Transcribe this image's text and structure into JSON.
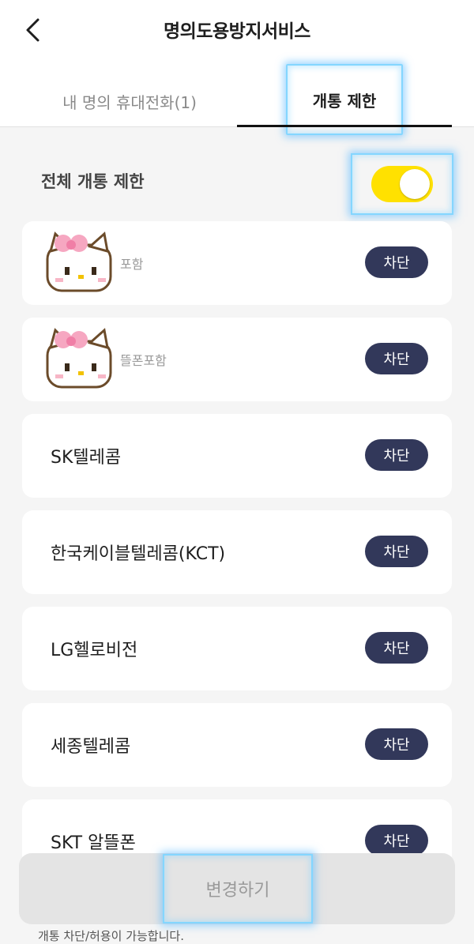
{
  "header": {
    "title": "명의도용방지서비스",
    "back_icon": "chevron-left-icon"
  },
  "tabs": [
    {
      "label": "내 명의 휴대전화(1)",
      "active": false
    },
    {
      "label": "개통 제한",
      "active": true
    }
  ],
  "all_restrict": {
    "label": "전체 개통 제한",
    "toggle_on": true,
    "toggle_color": "#ffe100"
  },
  "carriers": [
    {
      "label": "",
      "sub": "포함",
      "button": "차단",
      "icon": "hello-kitty-icon"
    },
    {
      "label": "",
      "sub": "뜰폰포함",
      "button": "차단",
      "icon": "hello-kitty-icon"
    },
    {
      "label": "SK텔레콤",
      "button": "차단"
    },
    {
      "label": "한국케이블텔레콤(KCT)",
      "button": "차단"
    },
    {
      "label": "LG헬로비전",
      "button": "차단"
    },
    {
      "label": "세종텔레콤",
      "button": "차단"
    },
    {
      "label": "SKT 알뜰폰",
      "button": "차단"
    }
  ],
  "footer": {
    "change_button": "변경하기",
    "note": "개통 차단/허용이 가능합니다."
  },
  "colors": {
    "accent_button": "#32385a",
    "toggle": "#ffe100",
    "highlight": "#84d6ff"
  }
}
